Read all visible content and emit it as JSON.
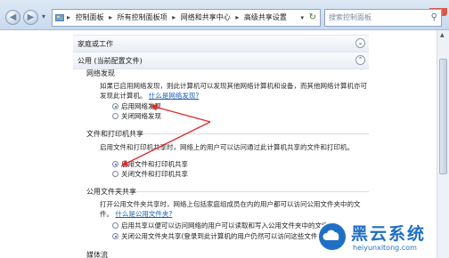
{
  "window": {
    "minimize": "─",
    "maximize": "□",
    "close": "✕"
  },
  "nav": {
    "back": "◀",
    "forward": "▶"
  },
  "breadcrumb": [
    "控制面板",
    "所有控制面板项",
    "网络和共享中心",
    "高级共享设置"
  ],
  "breadcrumb_sep": "▸",
  "search": {
    "placeholder": "搜索控制面板"
  },
  "profiles": {
    "home_label": "家庭或工作",
    "public_label": "公用 (当前配置文件)"
  },
  "network_discovery": {
    "heading": "网络发现",
    "description": "如果已启用网络发现，则此计算机可以发现其他网络计算机和设备，而其他网络计算机亦可发现此计算机。",
    "link": "什么是网络发现?",
    "options": [
      {
        "label": "启用网络发现",
        "selected": true
      },
      {
        "label": "关闭网络发现",
        "selected": false
      }
    ]
  },
  "file_printer_sharing": {
    "heading": "文件和打印机共享",
    "description": "启用文件和打印机共享时，网络上的用户可以访问通过此计算机共享的文件和打印机。",
    "options": [
      {
        "label": "启用文件和打印机共享",
        "selected": true
      },
      {
        "label": "关闭文件和打印机共享",
        "selected": false
      }
    ]
  },
  "public_folder_sharing": {
    "heading": "公用文件夹共享",
    "description": "打开公用文件夹共享时，网络上包括家庭组成员在内的用户都可以访问公用文件夹中的文件。",
    "link": "什么是公用文件夹?",
    "options": [
      {
        "label": "启用共享以便可以访问网络的用户可以读取和写入公用文件夹中的文件",
        "selected": false
      },
      {
        "label": "关闭公用文件夹共享(登录到此计算机的用户仍然可以访问这些文件夹)",
        "selected": true
      }
    ]
  },
  "media_streaming": {
    "heading": "媒体流"
  },
  "watermark": {
    "name": "黑云系统",
    "url": "heiyunxitong.com"
  },
  "colors": {
    "accent": "#1a5fb4",
    "annotation_arrow": "#e02b2b"
  }
}
